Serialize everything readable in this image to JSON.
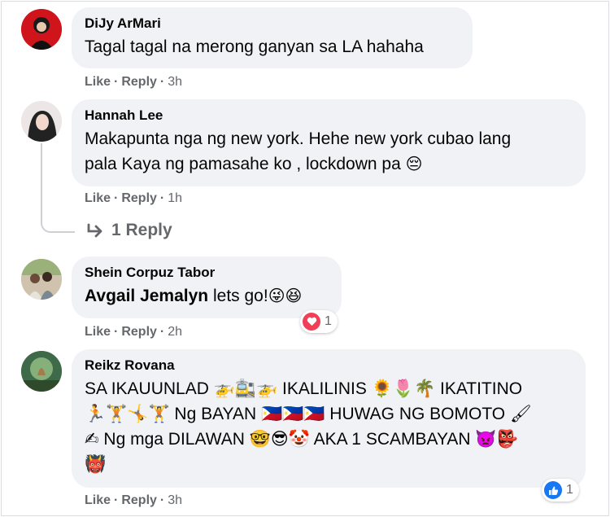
{
  "comments": [
    {
      "author": "DiJy ArMari",
      "text": "Tagal tagal na merong ganyan sa LA hahaha",
      "like": "Like",
      "reply": "Reply",
      "time": "3h"
    },
    {
      "author": "Hannah Lee",
      "text_line1": "Makapunta nga ng new york. Hehe new york cubao lang",
      "text_line2": "pala Kaya ng pamasahe ko , lockdown pa",
      "emoji": "😔",
      "like": "Like",
      "reply": "Reply",
      "time": "1h",
      "replies_label": "1 Reply"
    },
    {
      "author": "Shein Corpuz Tabor",
      "mention": "Avgail Jemalyn",
      "text": " lets go!",
      "emoji": "😜😆",
      "like": "Like",
      "reply": "Reply",
      "time": "2h",
      "reaction": "love",
      "reaction_count": "1"
    },
    {
      "author": "Reikz Rovana",
      "line1": "SA IKAUUNLAD 🚁🚉🚁 IKALILINIS 🌻🌷🌴 IKATITINO",
      "line2": "🏃🏋🤸🏋 Ng BAYAN 🇵🇭🇵🇭🇵🇭 HUWAG NG BOMOTO 🖌",
      "line3": "✍ Ng mga DILAWAN 🤓😎🤡 AKA 1 SCAMBAYAN 👿👺",
      "line4": "👹",
      "like": "Like",
      "reply": "Reply",
      "time": "3h",
      "reaction": "like",
      "reaction_count": "1"
    }
  ],
  "colors": {
    "bubble": "#f0f2f5",
    "meta": "#65676b",
    "love": "#f33e58",
    "like": "#1877f2"
  },
  "icons": [
    "reply-arrow-icon",
    "heart-icon",
    "thumbs-up-icon"
  ]
}
